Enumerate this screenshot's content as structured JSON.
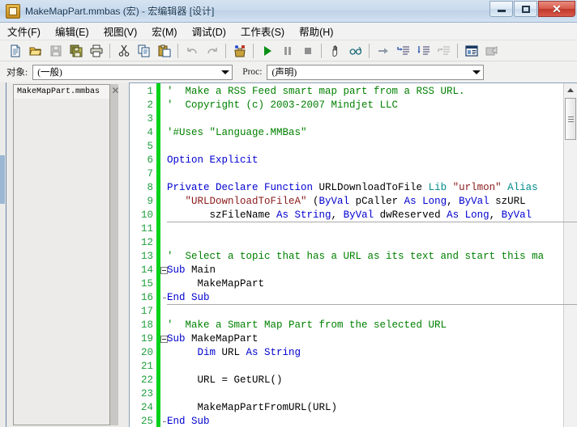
{
  "window": {
    "title": "MakeMapPart.mmbas (宏) - 宏编辑器 [设计]",
    "icon": "macro-file-icon",
    "controls": {
      "minimize": "—",
      "maximize": "▫",
      "close": "✕"
    }
  },
  "menubar": {
    "items": [
      {
        "label": "文件(F)",
        "name": "menu-file"
      },
      {
        "label": "编辑(E)",
        "name": "menu-edit"
      },
      {
        "label": "视图(V)",
        "name": "menu-view"
      },
      {
        "label": "宏(M)",
        "name": "menu-macro"
      },
      {
        "label": "调试(D)",
        "name": "menu-debug"
      },
      {
        "label": "工作表(S)",
        "name": "menu-worksheet"
      },
      {
        "label": "帮助(H)",
        "name": "menu-help"
      }
    ]
  },
  "toolbar": {
    "buttons": [
      {
        "icon": "new-file-icon",
        "enabled": true
      },
      {
        "icon": "open-folder-icon",
        "enabled": true
      },
      {
        "icon": "save-icon",
        "enabled": false
      },
      {
        "icon": "save-all-icon",
        "enabled": true
      },
      {
        "icon": "print-icon",
        "enabled": true
      },
      {
        "icon": "cut-icon",
        "enabled": true
      },
      {
        "icon": "copy-icon",
        "enabled": true
      },
      {
        "icon": "paste-icon",
        "enabled": true
      },
      {
        "icon": "undo-icon",
        "enabled": false
      },
      {
        "icon": "redo-icon",
        "enabled": false
      },
      {
        "icon": "macro-toolbox-icon",
        "enabled": true
      },
      {
        "icon": "run-icon",
        "enabled": true
      },
      {
        "icon": "pause-icon",
        "enabled": false
      },
      {
        "icon": "stop-icon",
        "enabled": false
      },
      {
        "icon": "breakpoint-hand-icon",
        "enabled": true
      },
      {
        "icon": "watch-glasses-icon",
        "enabled": true
      },
      {
        "icon": "current-line-arrow-icon",
        "enabled": false
      },
      {
        "icon": "step-into-icon",
        "enabled": true
      },
      {
        "icon": "step-over-icon",
        "enabled": true
      },
      {
        "icon": "step-out-icon",
        "enabled": false
      },
      {
        "icon": "properties-window-icon",
        "enabled": true
      },
      {
        "icon": "object-browser-icon",
        "enabled": false
      }
    ]
  },
  "objectbar": {
    "object_label": "对象:",
    "object_value": "(一般)",
    "proc_label": "Proc:",
    "proc_value": "(声明)",
    "dropdown_icon": "chevron-down-icon"
  },
  "sidebar": {
    "tab_label": "MakeMapPart.mmbas",
    "close_icon": "close-icon"
  },
  "editor": {
    "colors": {
      "comment": "#008000",
      "keyword": "#0000d0",
      "string": "#8b1a1a",
      "lib": "#008b8b",
      "linenumber": "#1f9e3c",
      "changebar": "#00d11a",
      "background": "#ffffff"
    },
    "first_visible_line": 1,
    "line_numbers": [
      1,
      2,
      3,
      4,
      5,
      6,
      7,
      8,
      9,
      10,
      11,
      12,
      13,
      14,
      15,
      16,
      17,
      18,
      19,
      20,
      21,
      22,
      23,
      24,
      25
    ],
    "fold_lines": [
      14,
      19
    ],
    "fold_end_lines": [
      16,
      25
    ],
    "separator_after_lines": [
      10,
      16,
      25
    ],
    "lines": [
      {
        "n": 1,
        "segments": [
          {
            "t": "'  Make a RSS Feed smart map part from a RSS URL.",
            "c": "cmt"
          }
        ]
      },
      {
        "n": 2,
        "segments": [
          {
            "t": "'  Copyright (c) 2003-2007 Mindjet LLC",
            "c": "cmt"
          }
        ]
      },
      {
        "n": 3,
        "segments": []
      },
      {
        "n": 4,
        "segments": [
          {
            "t": "'#Uses \"Language.MMBas\"",
            "c": "cmt"
          }
        ]
      },
      {
        "n": 5,
        "segments": []
      },
      {
        "n": 6,
        "segments": [
          {
            "t": "Option Explicit",
            "c": "kw"
          }
        ]
      },
      {
        "n": 7,
        "segments": []
      },
      {
        "n": 8,
        "segments": [
          {
            "t": "Private Declare Function ",
            "c": "kw"
          },
          {
            "t": "URLDownloadToFile ",
            "c": ""
          },
          {
            "t": "Lib ",
            "c": "lib"
          },
          {
            "t": "\"urlmon\" ",
            "c": "str"
          },
          {
            "t": "Alias",
            "c": "lib"
          }
        ]
      },
      {
        "n": 9,
        "segments": [
          {
            "t": "   \"URLDownloadToFileA\" ",
            "c": "str"
          },
          {
            "t": "(",
            "c": ""
          },
          {
            "t": "ByVal ",
            "c": "kw"
          },
          {
            "t": "pCaller ",
            "c": ""
          },
          {
            "t": "As Long",
            "c": "kw"
          },
          {
            "t": ", ",
            "c": ""
          },
          {
            "t": "ByVal ",
            "c": "kw"
          },
          {
            "t": "szURL",
            "c": ""
          }
        ]
      },
      {
        "n": 10,
        "segments": [
          {
            "t": "       szFileName ",
            "c": ""
          },
          {
            "t": "As String",
            "c": "kw"
          },
          {
            "t": ", ",
            "c": ""
          },
          {
            "t": "ByVal ",
            "c": "kw"
          },
          {
            "t": "dwReserved ",
            "c": ""
          },
          {
            "t": "As Long",
            "c": "kw"
          },
          {
            "t": ", ",
            "c": ""
          },
          {
            "t": "ByVal",
            "c": "kw"
          }
        ]
      },
      {
        "n": 11,
        "segments": []
      },
      {
        "n": 12,
        "segments": []
      },
      {
        "n": 13,
        "segments": [
          {
            "t": "'  Select a topic that has a URL as its text and start this ma",
            "c": "cmt"
          }
        ]
      },
      {
        "n": 14,
        "segments": [
          {
            "t": "Sub ",
            "c": "kw"
          },
          {
            "t": "Main",
            "c": ""
          }
        ]
      },
      {
        "n": 15,
        "segments": [
          {
            "t": "     MakeMapPart",
            "c": ""
          }
        ]
      },
      {
        "n": 16,
        "segments": [
          {
            "t": "End Sub",
            "c": "kw"
          }
        ]
      },
      {
        "n": 17,
        "segments": []
      },
      {
        "n": 18,
        "segments": [
          {
            "t": "'  Make a Smart Map Part from the selected URL",
            "c": "cmt"
          }
        ]
      },
      {
        "n": 19,
        "segments": [
          {
            "t": "Sub ",
            "c": "kw"
          },
          {
            "t": "MakeMapPart",
            "c": ""
          }
        ]
      },
      {
        "n": 20,
        "segments": [
          {
            "t": "     ",
            "c": ""
          },
          {
            "t": "Dim ",
            "c": "kw"
          },
          {
            "t": "URL ",
            "c": ""
          },
          {
            "t": "As String",
            "c": "kw"
          }
        ]
      },
      {
        "n": 21,
        "segments": []
      },
      {
        "n": 22,
        "segments": [
          {
            "t": "     URL = GetURL()",
            "c": ""
          }
        ]
      },
      {
        "n": 23,
        "segments": []
      },
      {
        "n": 24,
        "segments": [
          {
            "t": "     MakeMapPartFromURL(URL)",
            "c": ""
          }
        ]
      },
      {
        "n": 25,
        "segments": [
          {
            "t": "End Sub",
            "c": "kw"
          }
        ]
      }
    ],
    "scrollbar": {
      "up_arrow_icon": "scroll-up-arrow-icon",
      "thumb_grip_icon": "scroll-thumb-grip-icon"
    }
  }
}
